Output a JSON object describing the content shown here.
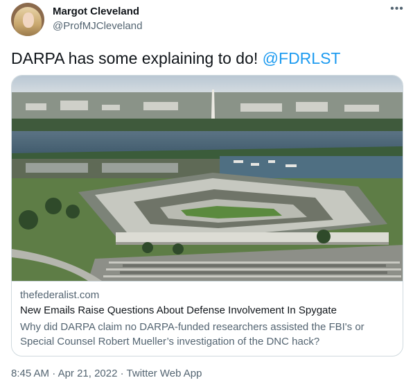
{
  "author": {
    "name": "Margot Cleveland",
    "handle": "@ProfMJCleveland"
  },
  "more_icon": "ellipsis-icon",
  "tweet": {
    "text": "DARPA has some explaining to do! ",
    "mention": "@FDRLST"
  },
  "card": {
    "domain": "thefederalist.com",
    "headline": "New Emails Raise Questions About Defense Involvement In Spygate",
    "description": "Why did DARPA claim no DARPA-funded researchers assisted the FBI's or Special Counsel Robert Mueller’s investigation of the DNC hack?"
  },
  "meta": {
    "time": "8:45 AM",
    "date": "Apr 21, 2022",
    "source": "Twitter Web App",
    "separator": "·"
  },
  "colors": {
    "link": "#1d9bf0",
    "secondary": "#536471",
    "primary": "#0f1419",
    "border": "#cfd9de"
  }
}
